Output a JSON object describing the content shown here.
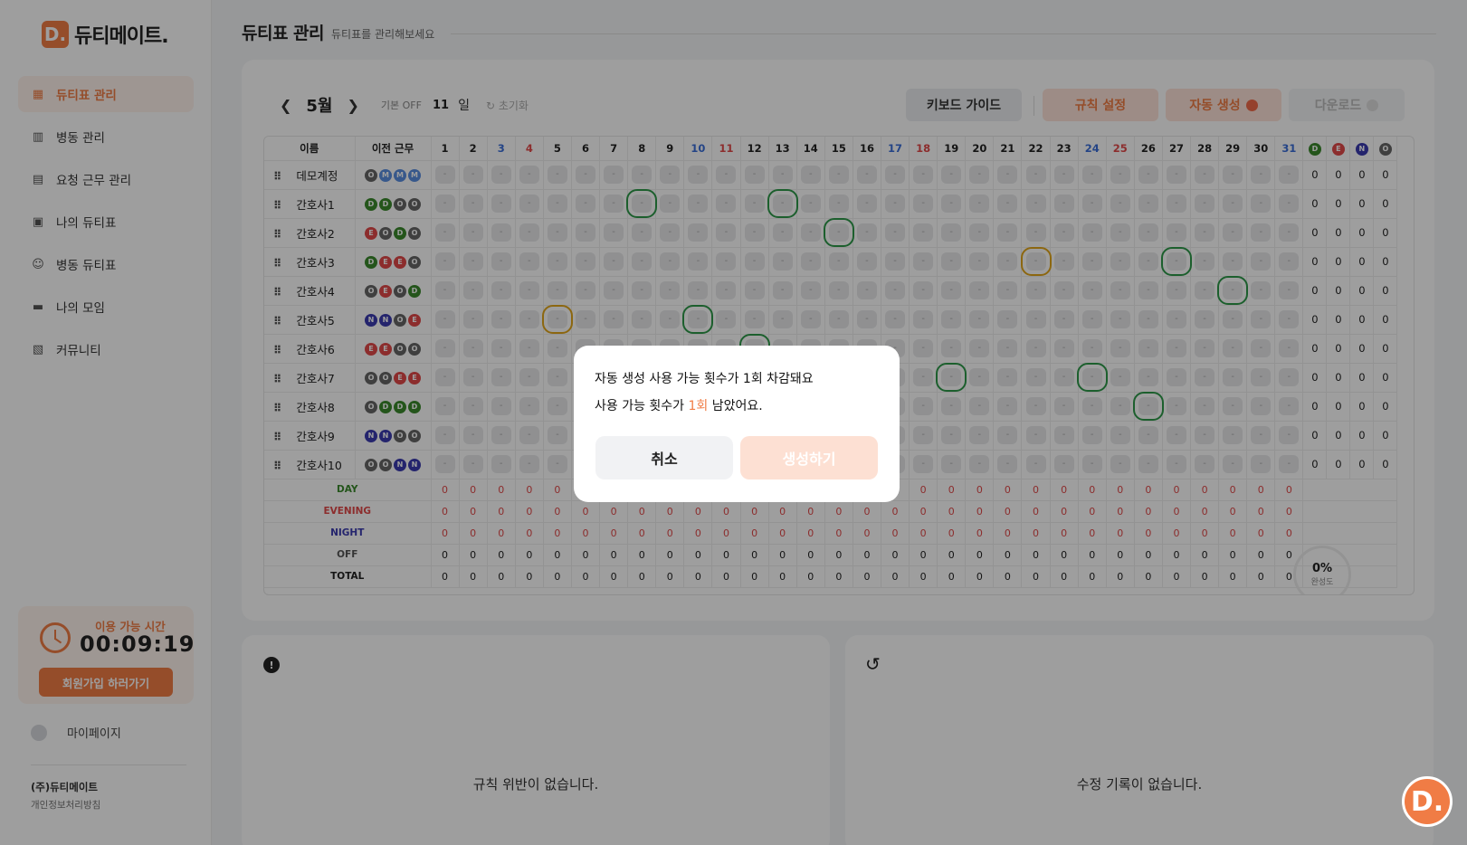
{
  "app": {
    "logo_mark": "D.",
    "logo_text": "듀티메이트."
  },
  "sidebar": {
    "items": [
      {
        "label": "듀티표 관리",
        "icon": "calendar-icon",
        "active": true
      },
      {
        "label": "병동 관리",
        "icon": "building-icon",
        "active": false
      },
      {
        "label": "요청 근무 관리",
        "icon": "inbox-icon",
        "active": false
      },
      {
        "label": "나의 듀티표",
        "icon": "bookmark-icon",
        "active": false
      },
      {
        "label": "병동 듀티표",
        "icon": "people-icon",
        "active": false
      },
      {
        "label": "나의 모임",
        "icon": "chat-icon",
        "active": false
      },
      {
        "label": "커뮤니티",
        "icon": "community-icon",
        "active": false
      }
    ],
    "timer_label": "이용 가능 시간",
    "timer_value": "00:09:19",
    "signup_label": "회원가입 하러가기",
    "mypage_label": "마이페이지",
    "company": "(주)듀티메이트",
    "privacy": "개인정보처리방침"
  },
  "header": {
    "title": "듀티표 관리",
    "subtitle": "듀티표를 관리해보세요"
  },
  "toolbar": {
    "month": "5월",
    "base_off_label": "기본 OFF",
    "base_off_value": "11",
    "base_off_unit": "일",
    "reset_label": "초기화",
    "guide_label": "키보드 가이드",
    "rule_label": "규칙 설정",
    "auto_label": "자동 생성",
    "download_label": "다운로드"
  },
  "table": {
    "col_name": "이름",
    "col_prev": "이전 근무",
    "days": [
      "1",
      "2",
      "3",
      "4",
      "5",
      "6",
      "7",
      "8",
      "9",
      "10",
      "11",
      "12",
      "13",
      "14",
      "15",
      "16",
      "17",
      "18",
      "19",
      "20",
      "21",
      "22",
      "23",
      "24",
      "25",
      "26",
      "27",
      "28",
      "29",
      "30",
      "31"
    ],
    "count_headers": [
      "D",
      "E",
      "N",
      "O"
    ],
    "nurses": [
      {
        "name": "데모계정",
        "prev": [
          "O",
          "M",
          "M",
          "M"
        ]
      },
      {
        "name": "간호사1",
        "prev": [
          "D",
          "D",
          "O",
          "O"
        ]
      },
      {
        "name": "간호사2",
        "prev": [
          "E",
          "O",
          "D",
          "O"
        ]
      },
      {
        "name": "간호사3",
        "prev": [
          "D",
          "E",
          "E",
          "O"
        ]
      },
      {
        "name": "간호사4",
        "prev": [
          "O",
          "E",
          "O",
          "D"
        ]
      },
      {
        "name": "간호사5",
        "prev": [
          "N",
          "N",
          "O",
          "E"
        ]
      },
      {
        "name": "간호사6",
        "prev": [
          "E",
          "E",
          "O",
          "O"
        ]
      },
      {
        "name": "간호사7",
        "prev": [
          "O",
          "O",
          "E",
          "E"
        ]
      },
      {
        "name": "간호사8",
        "prev": [
          "O",
          "D",
          "D",
          "D"
        ]
      },
      {
        "name": "간호사9",
        "prev": [
          "N",
          "N",
          "O",
          "O"
        ]
      },
      {
        "name": "간호사10",
        "prev": [
          "O",
          "O",
          "N",
          "N"
        ]
      }
    ],
    "cell_placeholder": "-",
    "count_value": "0",
    "stats": [
      "DAY",
      "EVENING",
      "NIGHT",
      "OFF",
      "TOTAL"
    ],
    "stat_value": "0",
    "progress_value": "0%",
    "progress_label": "완성도"
  },
  "panels": {
    "rules_empty": "규칙 위반이 없습니다.",
    "history_empty": "수정 기록이 없습니다."
  },
  "modal": {
    "title": "자동 생성 사용 가능 횟수가 1회 차감돼요",
    "desc_prefix": "사용 가능 횟수가 ",
    "desc_highlight": "1회",
    "desc_suffix": " 남았어요.",
    "cancel_label": "취소",
    "confirm_label": "생성하기"
  },
  "fab": {
    "label": "D."
  },
  "colors": {
    "accent": "#f07c45",
    "day": "#3a8a2d",
    "evening": "#e24a4a",
    "night": "#3b3bb0",
    "off": "#666666"
  }
}
